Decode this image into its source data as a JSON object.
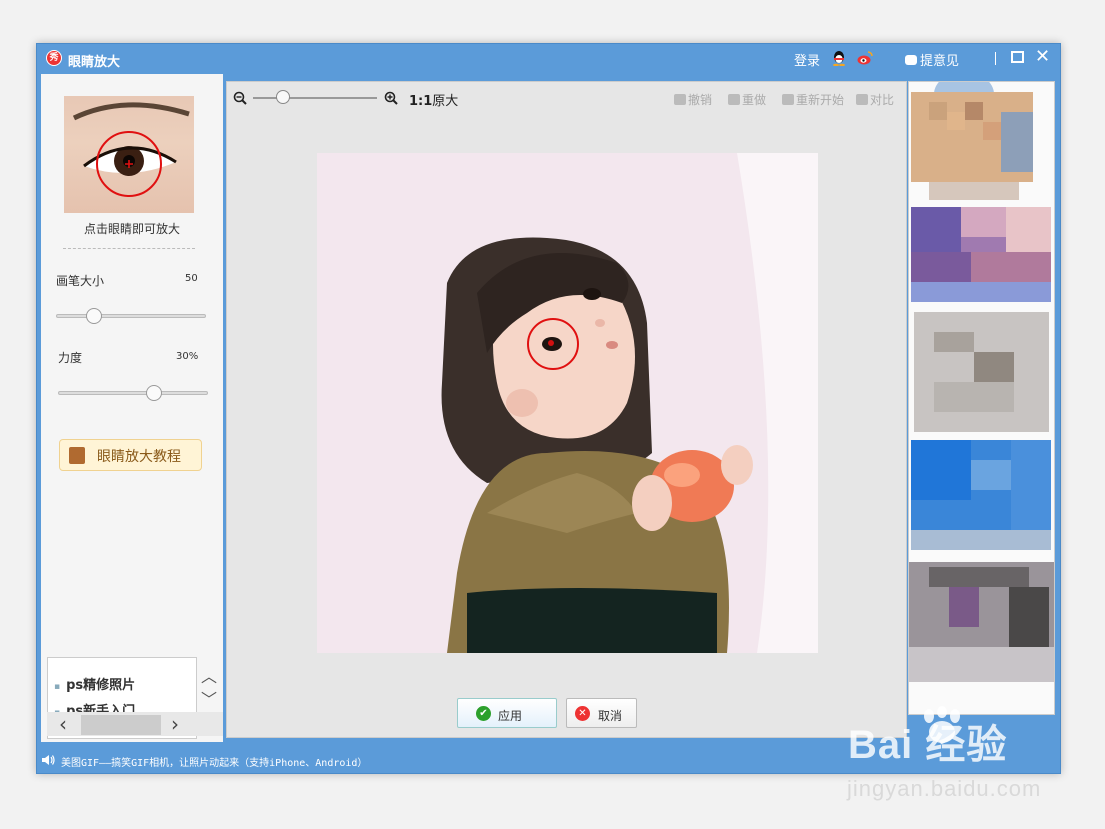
{
  "window": {
    "title": "眼睛放大",
    "login": "登录",
    "feedback": "提意见",
    "colors": {
      "titlebar": "#5b9bd9",
      "accent": "#e33333"
    }
  },
  "left": {
    "hint": "点击眼睛即可放大",
    "brush_label": "画笔大小",
    "brush_value": "50",
    "brush_level": 0.25,
    "strength_label": "力度",
    "strength_value": "30%",
    "strength_level": 0.64,
    "tutorial_label": "眼睛放大教程",
    "links": [
      "ps精修照片",
      "ps新手入门"
    ]
  },
  "toolbar": {
    "ratio_bold": "1:1",
    "ratio_label": "原大",
    "undo": "撤销",
    "redo": "重做",
    "restart": "重新开始",
    "compare": "对比"
  },
  "actions": {
    "apply": "应用",
    "cancel": "取消"
  },
  "status": {
    "text": "美图GIF——搞笑GIF相机，让照片动起来（支持iPhone、Android）"
  },
  "watermark": {
    "logo": "Bai  经验",
    "url": "jingyan.baidu.com"
  },
  "icons": [
    "app-logo-icon",
    "qq-icon",
    "weibo-icon",
    "feedback-icon",
    "maximize-icon",
    "close-icon",
    "zoom-out-icon",
    "zoom-in-icon",
    "undo-icon",
    "redo-icon",
    "restart-icon",
    "compare-icon",
    "check-icon",
    "cancel-x-icon",
    "book-icon",
    "speaker-icon",
    "chevron-up-icon",
    "chevron-down-icon",
    "chevron-left-icon",
    "chevron-right-icon"
  ]
}
